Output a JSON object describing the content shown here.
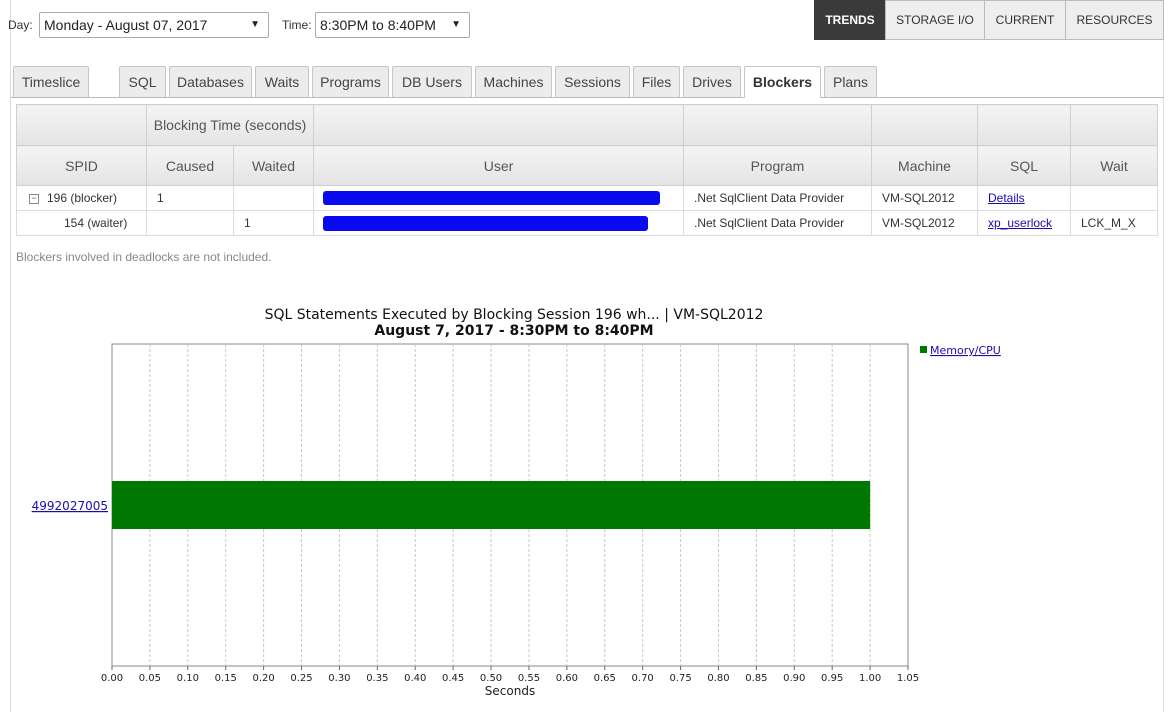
{
  "toolbar": {
    "day_label": "Day:",
    "day_value": "Monday - August 07, 2017",
    "time_label": "Time:",
    "time_value": "8:30PM to 8:40PM",
    "nav": [
      "TRENDS",
      "STORAGE I/O",
      "CURRENT",
      "RESOURCES"
    ],
    "active_nav": "TRENDS"
  },
  "tabs": [
    "Timeslice",
    "SQL",
    "Databases",
    "Waits",
    "Programs",
    "DB Users",
    "Machines",
    "Sessions",
    "Files",
    "Drives",
    "Blockers",
    "Plans"
  ],
  "active_tab": "Blockers",
  "table": {
    "group_header": "Blocking Time (seconds)",
    "columns": [
      "SPID",
      "Caused",
      "Waited",
      "User",
      "Program",
      "Machine",
      "SQL",
      "Wait"
    ],
    "rows": [
      {
        "spid": "196 (blocker)",
        "caused": "1",
        "waited": "",
        "user": "",
        "program": ".Net SqlClient Data Provider",
        "machine": "VM-SQL2012",
        "sql": "Details",
        "wait": ""
      },
      {
        "spid": "154 (waiter)",
        "caused": "",
        "waited": "1",
        "user": "",
        "program": ".Net SqlClient Data Provider",
        "machine": "VM-SQL2012",
        "sql": "xp_userlock",
        "wait": "LCK_M_X"
      }
    ]
  },
  "note": "Blockers involved in deadlocks are not included.",
  "chart_data": {
    "type": "bar",
    "orientation": "horizontal",
    "title": "SQL Statements Executed by Blocking Session 196 wh... | VM-SQL2012",
    "subtitle": "August 7, 2017 - 8:30PM to 8:40PM",
    "xlabel": "Seconds",
    "ylabel": "",
    "categories": [
      "4992027005"
    ],
    "series": [
      {
        "name": "Memory/CPU",
        "values": [
          1.0
        ],
        "color": "#007700"
      }
    ],
    "xlim": [
      0,
      1.05
    ],
    "xticks": [
      "0.00",
      "0.05",
      "0.10",
      "0.15",
      "0.20",
      "0.25",
      "0.30",
      "0.35",
      "0.40",
      "0.45",
      "0.50",
      "0.55",
      "0.60",
      "0.65",
      "0.70",
      "0.75",
      "0.80",
      "0.85",
      "0.90",
      "0.95",
      "1.00",
      "1.05"
    ],
    "grid": true,
    "legend": "top-right"
  }
}
